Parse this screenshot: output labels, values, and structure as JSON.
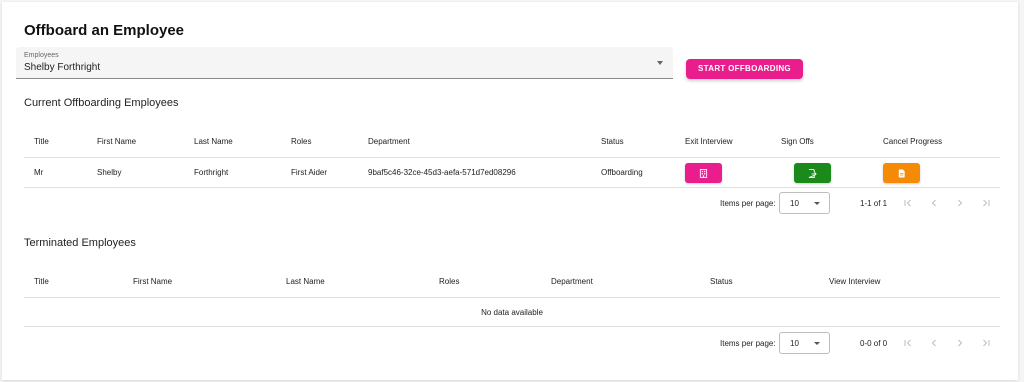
{
  "page": {
    "title": "Offboard an Employee"
  },
  "employee_select": {
    "label": "Employees",
    "value": "Shelby Forthright"
  },
  "start_button": {
    "label": "START OFFBOARDING",
    "color": "#e91e8c"
  },
  "current_section": {
    "title": "Current Offboarding Employees",
    "columns": [
      "Title",
      "First Name",
      "Last Name",
      "Roles",
      "Department",
      "Status",
      "Exit Interview",
      "Sign Offs",
      "Cancel Progress"
    ],
    "rows": [
      {
        "title": "Mr",
        "first_name": "Shelby",
        "last_name": "Forthright",
        "roles": "First Aider",
        "department": "9baf5c46-32ce-45d3-aefa-571d7ed08296",
        "status": "Offboarding",
        "exit_interview_icon": "interview-form-icon",
        "sign_offs_icon": "sign-off-icon",
        "cancel_icon": "document-icon"
      }
    ],
    "action_colors": {
      "exit_interview": "#e91e8c",
      "sign_offs": "#1b8a1b",
      "cancel_progress": "#f58a07"
    },
    "paginator": {
      "items_per_page_label": "Items per page:",
      "page_size": "10",
      "range": "1-1 of 1"
    }
  },
  "terminated_section": {
    "title": "Terminated Employees",
    "columns": [
      "Title",
      "First Name",
      "Last Name",
      "Roles",
      "Department",
      "Status",
      "View Interview"
    ],
    "empty_message": "No data available",
    "paginator": {
      "items_per_page_label": "Items per page:",
      "page_size": "10",
      "range": "0-0 of 0"
    }
  }
}
